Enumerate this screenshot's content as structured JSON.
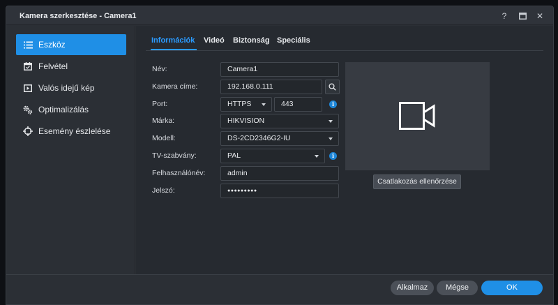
{
  "window": {
    "title": "Kamera szerkesztése - Camera1"
  },
  "titlebar": {
    "help_label": "?",
    "close_label": "✕"
  },
  "sidebar": {
    "items": [
      {
        "label": "Eszköz",
        "icon": "list-icon",
        "active": true
      },
      {
        "label": "Felvétel",
        "icon": "calendar-icon",
        "active": false
      },
      {
        "label": "Valós idejű kép",
        "icon": "live-view-icon",
        "active": false
      },
      {
        "label": "Optimalizálás",
        "icon": "gears-icon",
        "active": false
      },
      {
        "label": "Esemény észlelése",
        "icon": "crosshair-icon",
        "active": false
      }
    ]
  },
  "tabs": [
    {
      "label": "Információk",
      "active": true
    },
    {
      "label": "Videó",
      "active": false
    },
    {
      "label": "Biztonság",
      "active": false
    },
    {
      "label": "Speciális",
      "active": false
    }
  ],
  "form": {
    "name": {
      "label": "Név:",
      "value": "Camera1"
    },
    "address": {
      "label": "Kamera címe:",
      "value": "192.168.0.111"
    },
    "port": {
      "label": "Port:",
      "protocol": "HTTPS",
      "value": "443"
    },
    "brand": {
      "label": "Márka:",
      "value": "HIKVISION"
    },
    "model": {
      "label": "Modell:",
      "value": "DS-2CD2346G2-IU"
    },
    "tv_standard": {
      "label": "TV-szabvány:",
      "value": "PAL"
    },
    "username": {
      "label": "Felhasználónév:",
      "value": "admin"
    },
    "password": {
      "label": "Jelszó:",
      "value": "●●●●●●●●●"
    }
  },
  "info_icon": "i",
  "preview": {
    "icon": "video-camera-icon",
    "test_button": "Csatlakozás ellenőrzése"
  },
  "footer": {
    "apply": "Alkalmaz",
    "cancel": "Mégse",
    "ok": "OK"
  },
  "colors": {
    "accent": "#1f8fe6",
    "tab_active": "#2b9bff",
    "background": "#2b2f35"
  }
}
